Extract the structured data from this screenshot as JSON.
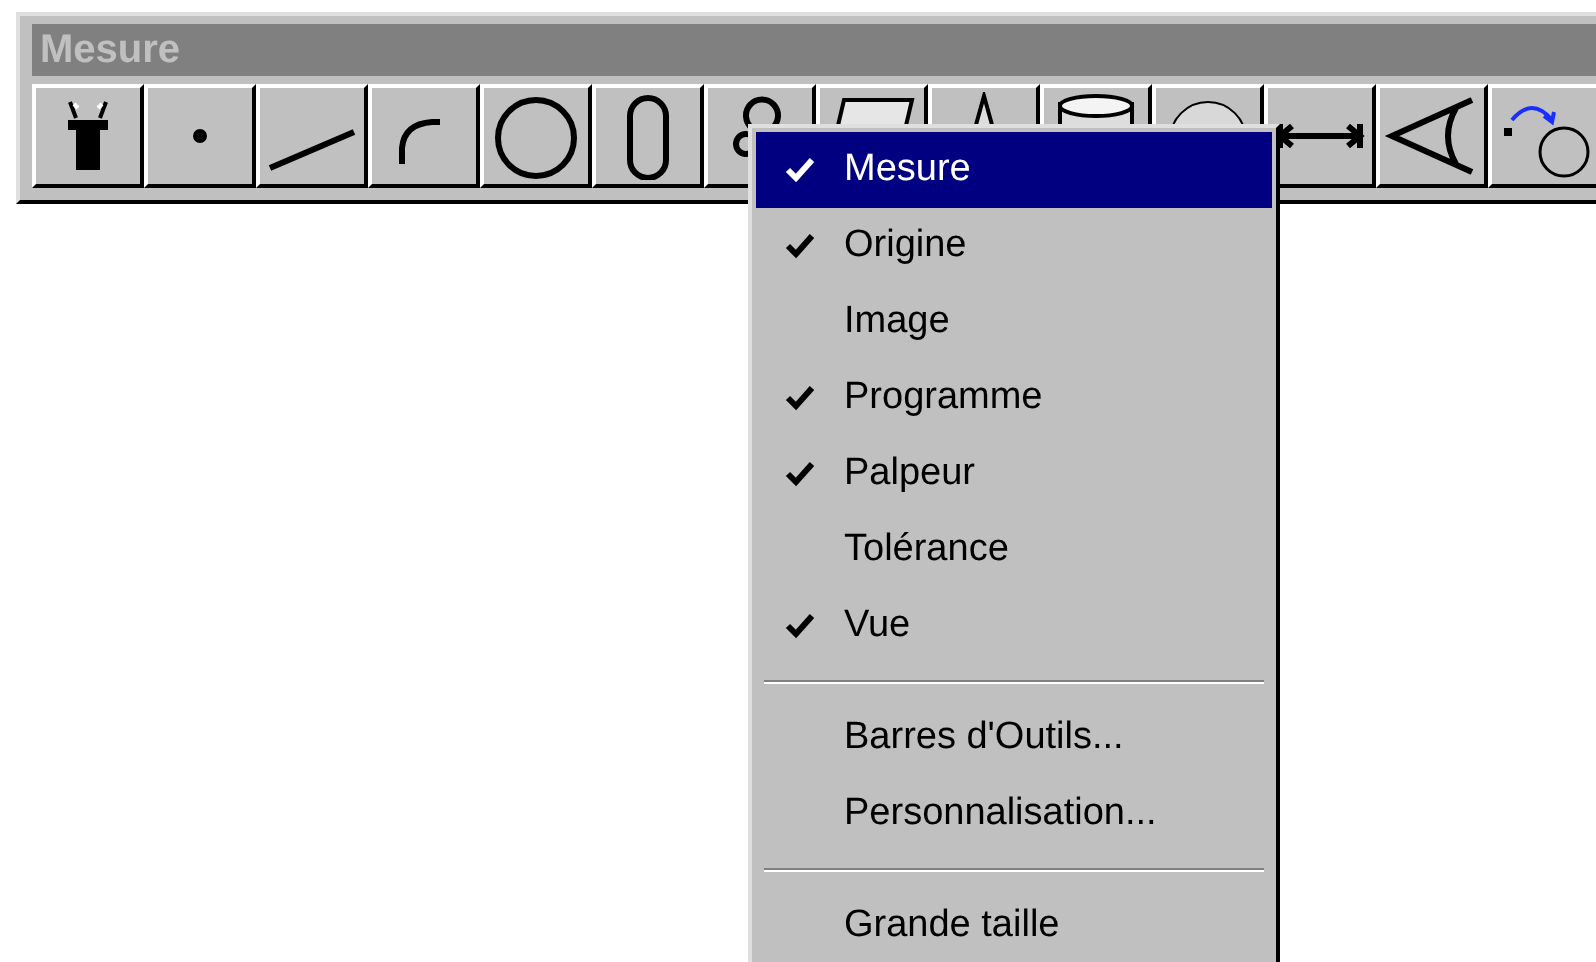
{
  "window": {
    "title": "Mesure"
  },
  "context_menu": {
    "items": [
      {
        "kind": "item",
        "label": "Mesure",
        "checked": true,
        "selected": true
      },
      {
        "kind": "item",
        "label": "Origine",
        "checked": true,
        "selected": false
      },
      {
        "kind": "item",
        "label": "Image",
        "checked": false,
        "selected": false
      },
      {
        "kind": "item",
        "label": "Programme",
        "checked": true,
        "selected": false
      },
      {
        "kind": "item",
        "label": "Palpeur",
        "checked": true,
        "selected": false
      },
      {
        "kind": "item",
        "label": "Tolérance",
        "checked": false,
        "selected": false
      },
      {
        "kind": "item",
        "label": "Vue",
        "checked": true,
        "selected": false
      },
      {
        "kind": "separator"
      },
      {
        "kind": "item",
        "label": "Barres d'Outils...",
        "checked": false,
        "selected": false
      },
      {
        "kind": "item",
        "label": "Personnalisation...",
        "checked": false,
        "selected": false
      },
      {
        "kind": "separator"
      },
      {
        "kind": "item",
        "label": "Grande taille",
        "checked": false,
        "selected": false
      }
    ]
  }
}
